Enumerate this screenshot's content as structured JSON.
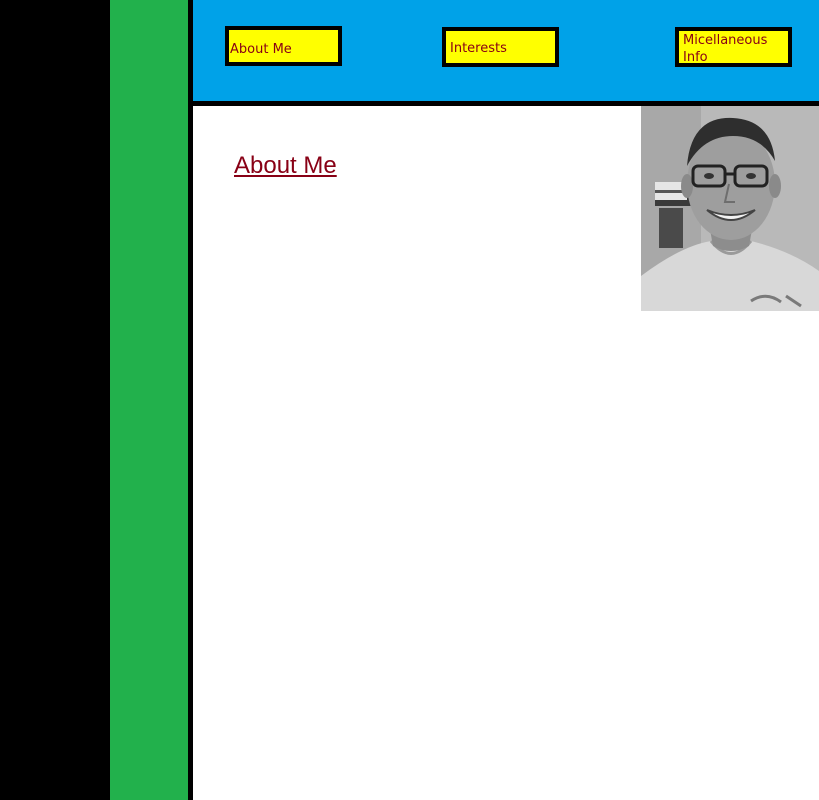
{
  "nav": {
    "about_label": "About Me",
    "interests_label": "Interests",
    "misc_label": "Micellaneous\n  Info"
  },
  "main": {
    "heading": "About Me"
  },
  "colors": {
    "left_column": "#000000",
    "sidebar": "#22b14c",
    "header": "#00a2e8",
    "button_bg": "#ffff00",
    "button_text": "#880015",
    "heading_text": "#880015"
  },
  "photo": {
    "icon": "profile-photo"
  }
}
